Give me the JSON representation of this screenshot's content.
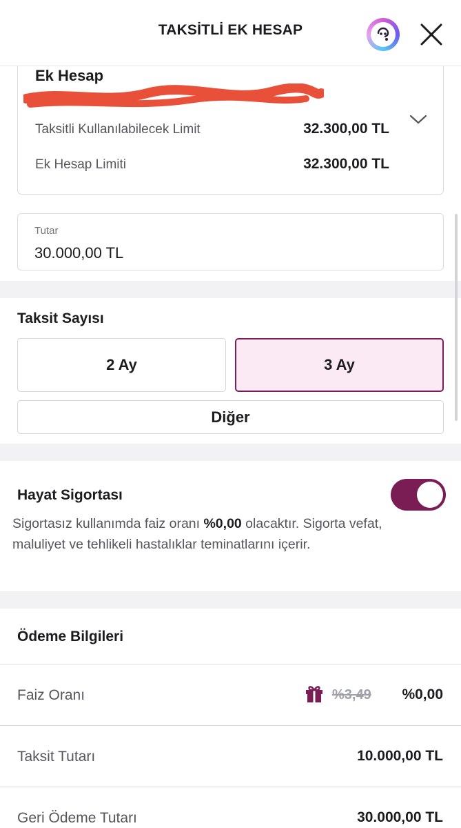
{
  "header": {
    "title": "TAKSİTLİ EK HESAP",
    "assistant_icon": "assistant-chat-icon",
    "close_icon": "close-icon"
  },
  "account": {
    "name": "Ek Hesap",
    "rows": [
      {
        "label": "Taksitli Kullanılabilecek Limit",
        "value": "32.300,00 TL"
      },
      {
        "label": "Ek Hesap Limiti",
        "value": "32.300,00 TL"
      }
    ]
  },
  "amount": {
    "label": "Tutar",
    "value": "30.000,00 TL"
  },
  "installments": {
    "title": "Taksit Sayısı",
    "options": [
      "2 Ay",
      "3 Ay"
    ],
    "selected": "3 Ay",
    "other_label": "Diğer"
  },
  "insurance": {
    "title": "Hayat Sigortası",
    "enabled": true,
    "desc_before": "Sigortasız kullanımda faiz oranı ",
    "desc_rate": "%0,00",
    "desc_after": " olacaktır. Sigorta vefat, maluliyet ve tehlikeli hastalıklar teminatlarını içerir."
  },
  "payment": {
    "title": "Ödeme Bilgileri",
    "interest_label": "Faiz Oranı",
    "interest_old": "%3,49",
    "interest_new": "%0,00",
    "installment_label": "Taksit Tutarı",
    "installment_value": "10.000,00 TL",
    "repayment_label": "Geri Ödeme Tutarı",
    "repayment_value": "30.000,00 TL"
  },
  "colors": {
    "brand": "#7a1d54",
    "selected_bg": "#fbeaf4",
    "redaction": "#e8503a"
  }
}
